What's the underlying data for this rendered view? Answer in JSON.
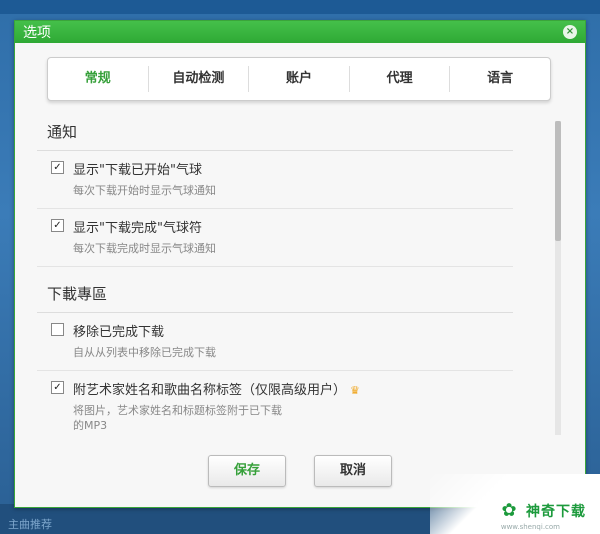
{
  "dialog": {
    "title": "选项"
  },
  "tabs": [
    {
      "label": "常规",
      "active": true
    },
    {
      "label": "自动检测",
      "active": false
    },
    {
      "label": "账户",
      "active": false
    },
    {
      "label": "代理",
      "active": false
    },
    {
      "label": "语言",
      "active": false
    }
  ],
  "sections": {
    "notifications": {
      "title": "通知",
      "items": [
        {
          "label": "显示\"下载已开始\"气球",
          "desc": "每次下载开始时显示气球通知",
          "checked": true
        },
        {
          "label": "显示\"下载完成\"气球符",
          "desc": "每次下载完成时显示气球通知",
          "checked": true
        }
      ]
    },
    "downloads": {
      "title": "下載專區",
      "items": [
        {
          "label": "移除已完成下载",
          "desc": "自从从列表中移除已完成下载",
          "checked": false
        },
        {
          "label": "附艺术家姓名和歌曲名称标签（仅限高级用户）",
          "desc_line1": "将图片，艺术家姓名和标题标签附于已下载",
          "desc_line2": "的MP3",
          "checked": true,
          "crown_icon": "crown-icon"
        }
      ]
    }
  },
  "buttons": {
    "save": "保存",
    "cancel": "取消"
  },
  "watermark": {
    "text": "神奇下载",
    "sub": "www.shenqi.com"
  },
  "background": {
    "bottom_text": "主曲推荐"
  },
  "colors": {
    "accent": "#36a03a",
    "titlebar": "#2fa935"
  }
}
